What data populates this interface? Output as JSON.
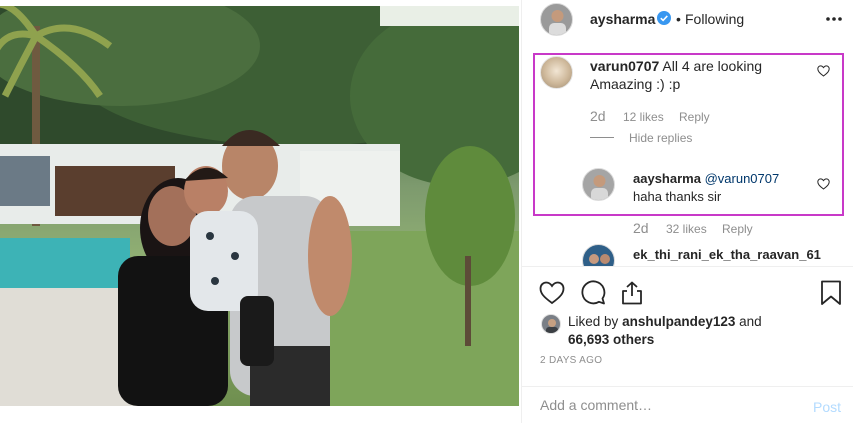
{
  "post": {
    "username": "aysharma",
    "separator": "•",
    "follow_status": "Following",
    "more_icon": "more-horizontal-icon",
    "verified_icon": "verified-badge-icon"
  },
  "comments": [
    {
      "username": "varun0707",
      "text": "All 4 are looking Amaazing :) :p",
      "age": "2d",
      "likes": "12 likes",
      "reply_label": "Reply",
      "hide_replies_label": "Hide replies"
    }
  ],
  "reply": {
    "username": "aaysharma",
    "mention": "@varun0707",
    "text": "haha thanks sir",
    "age": "2d",
    "likes": "32 likes",
    "reply_label": "Reply"
  },
  "next_comment": {
    "username": "ek_thi_rani_ek_tha_raavan_61"
  },
  "likes": {
    "prefix": "Liked by",
    "user": "anshulpandey123",
    "connector": "and",
    "others": "66,693 others"
  },
  "timestamp": "2 DAYS AGO",
  "add_comment": {
    "placeholder": "Add a comment…",
    "post_label": "Post"
  },
  "colors": {
    "highlight_border": "#c839c8",
    "post_button": "#b3dbff",
    "verified": "#3897f0"
  }
}
